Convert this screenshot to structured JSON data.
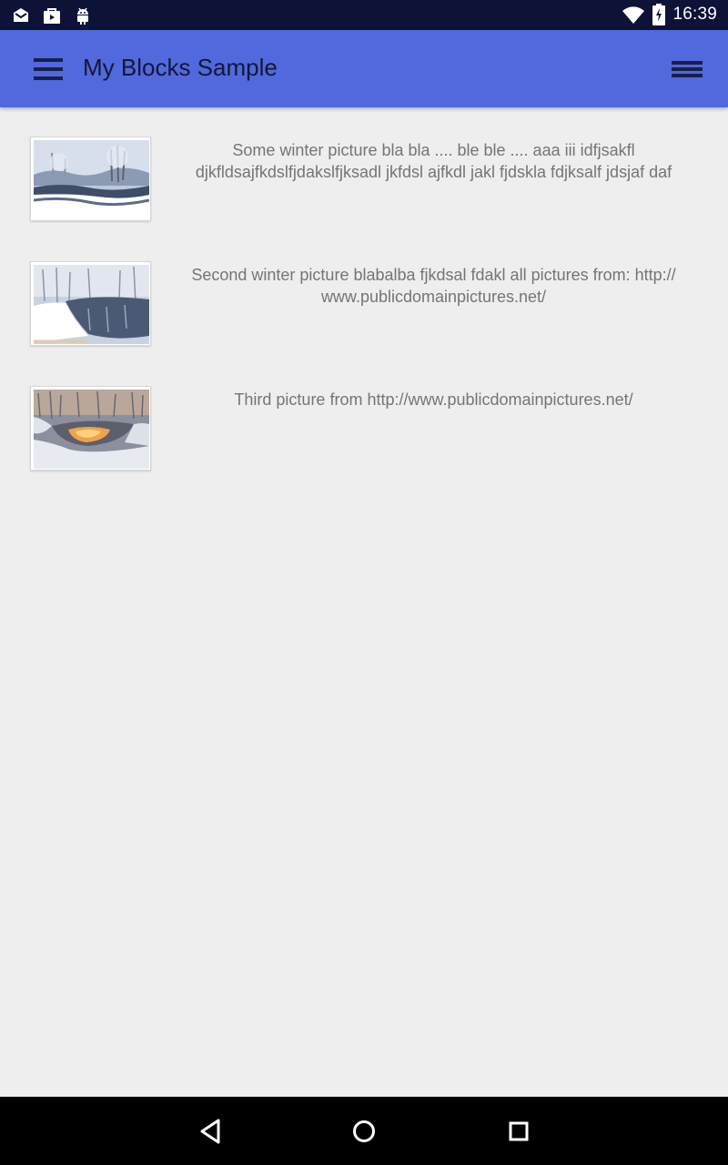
{
  "status_bar": {
    "time": "16:39",
    "icons": [
      "mail-icon",
      "shopping-bag-icon",
      "android-icon",
      "wifi-icon",
      "battery-charging-icon"
    ]
  },
  "app_bar": {
    "title": "My Blocks Sample",
    "nav_icon": "hamburger-menu-icon",
    "menu_icon": "list-menu-icon",
    "color": "#5169dd"
  },
  "items": [
    {
      "caption": "Some winter picture bla bla .... ble ble .... aaa iii idfjsakfl djkfldsajfkdslfjdakslfjksadl jkfdsl ajfkdl jakl fjdskla fdjksalf jdsjaf daf"
    },
    {
      "caption": "Second winter picture blabalba fjkdsal fdakl all pictures from: http:// www.publicdomainpictures.net/"
    },
    {
      "caption": "Third picture from http://www.publicdomainpictures.net/"
    }
  ],
  "nav_bar": {
    "buttons": [
      "back-icon",
      "home-icon",
      "recents-icon"
    ]
  },
  "colors": {
    "status_bar": "#0d1237",
    "background": "#eeeeee",
    "caption_text": "#757575",
    "title_text": "#13173a"
  }
}
